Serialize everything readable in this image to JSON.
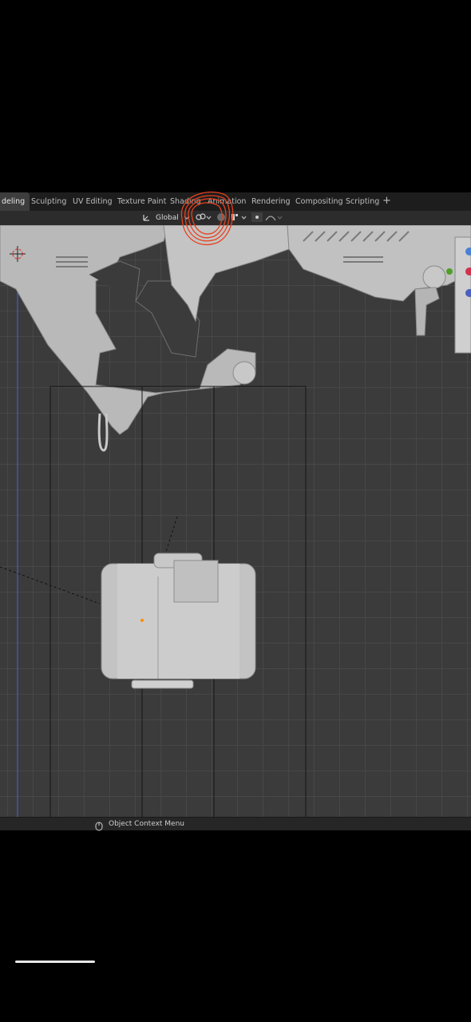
{
  "workspace_tabs": [
    {
      "label": "deling",
      "active": true
    },
    {
      "label": "Sculpting",
      "active": false
    },
    {
      "label": "UV Editing",
      "active": false
    },
    {
      "label": "Texture Paint",
      "active": false
    },
    {
      "label": "Shading",
      "active": false
    },
    {
      "label": "Animation",
      "active": false
    },
    {
      "label": "Rendering",
      "active": false
    },
    {
      "label": "Compositing",
      "active": false
    },
    {
      "label": "Scripting",
      "active": false
    }
  ],
  "add_workspace_label": "+",
  "header": {
    "orientation_label": "Global",
    "transform_orientation_icon": "axes-icon",
    "pivot_icon": "link-icon",
    "snap_icon": "magnet-icon",
    "proportional_icon": "proportional-edit-icon"
  },
  "statusbar": {
    "mouse_icon": "mouse-icon",
    "hint": "Object Context Menu"
  },
  "colors": {
    "annotation_red": "#e8401c",
    "axis_blue": "#4a5fbf",
    "axis_red": "#d2304a",
    "axis_green": "#4fa02a"
  }
}
